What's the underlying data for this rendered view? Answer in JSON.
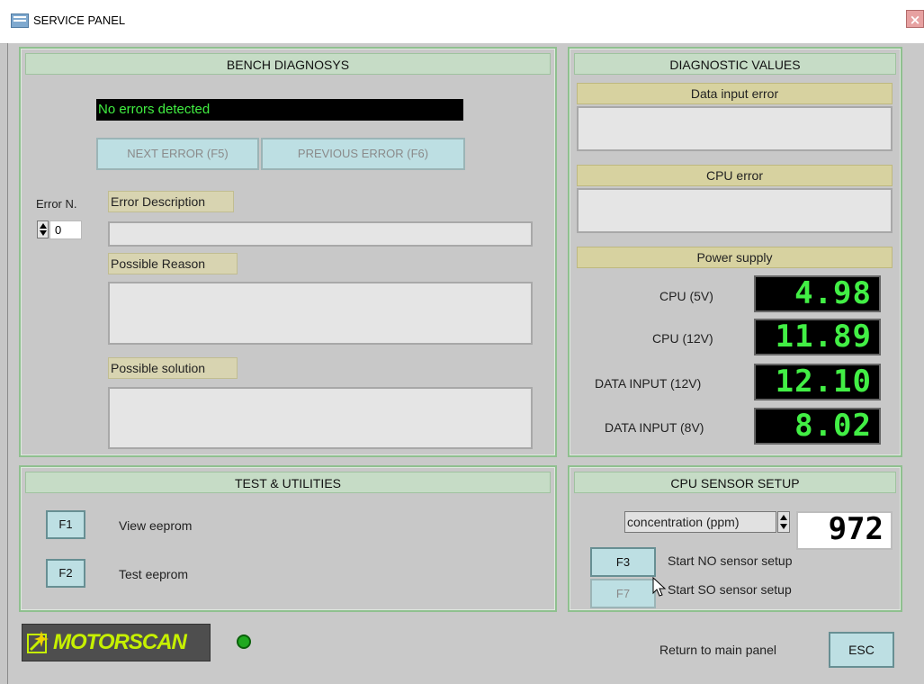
{
  "window": {
    "title": "SERVICE PANEL",
    "close_symbol": "×"
  },
  "bench_diagnosys": {
    "title": "BENCH DIAGNOSYS",
    "status": "No errors detected",
    "next_error_label": "NEXT ERROR (F5)",
    "previous_error_label": "PREVIOUS ERROR (F6)",
    "error_number_label": "Error N.",
    "error_number_value": "0",
    "error_description_label": "Error Description",
    "possible_reason_label": "Possible Reason",
    "possible_solution_label": "Possible solution"
  },
  "diagnostic_values": {
    "title": "DIAGNOSTIC VALUES",
    "data_input_error_label": "Data input error",
    "cpu_error_label": "CPU error",
    "power_supply_label": "Power supply",
    "readings": [
      {
        "label": "CPU (5V)",
        "value": "4.98"
      },
      {
        "label": "CPU (12V)",
        "value": "11.89"
      },
      {
        "label": "DATA INPUT (12V)",
        "value": "12.10"
      },
      {
        "label": "DATA INPUT (8V)",
        "value": "8.02"
      }
    ]
  },
  "test_utilities": {
    "title": "TEST & UTILITIES",
    "items": [
      {
        "key": "F1",
        "label": "View eeprom"
      },
      {
        "key": "F2",
        "label": "Test eeprom"
      }
    ]
  },
  "cpu_sensor_setup": {
    "title": "CPU SENSOR SETUP",
    "concentration_label": "concentration (ppm)",
    "concentration_value": "972",
    "items": [
      {
        "key": "F3",
        "label": "Start NO sensor setup"
      },
      {
        "key": "F7",
        "label": "Start SO sensor setup"
      }
    ]
  },
  "footer": {
    "logo_text": "MOTORSCAN",
    "return_label": "Return to main panel",
    "esc_label": "ESC"
  },
  "colors": {
    "panel_border": "#8fc08f",
    "lcd_text": "#42ef45",
    "status_led": "#1fa91f"
  }
}
